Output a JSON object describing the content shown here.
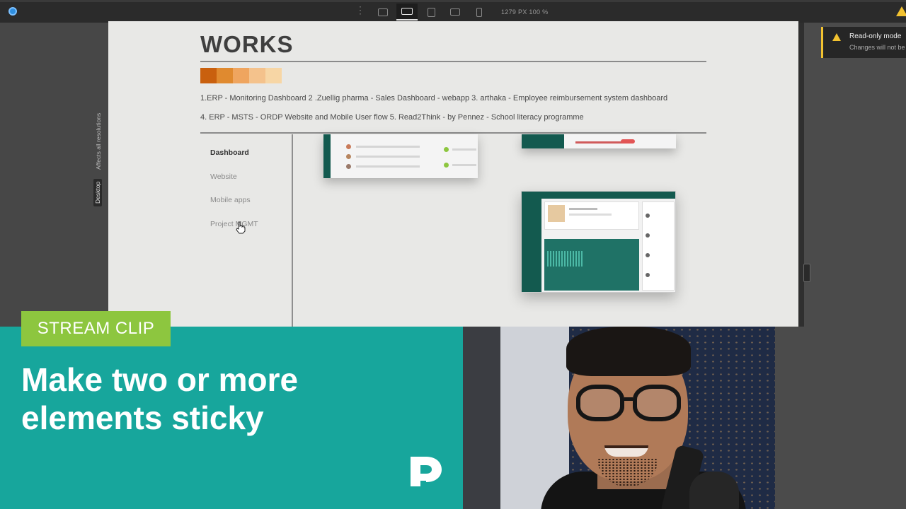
{
  "toolbar": {
    "size_label": "1279 PX   100 %",
    "devices": [
      "desktop-icon",
      "laptop-icon",
      "tablet-landscape-icon",
      "tablet-icon",
      "mobile-icon"
    ]
  },
  "gutter": {
    "affects_label": "Affects all resolutions",
    "breakpoint_label": "Desktop"
  },
  "canvas": {
    "title": "WORKS",
    "swatch_colors": [
      "#c9600e",
      "#e08a2f",
      "#efa55f",
      "#f4c28c",
      "#f7d6a5"
    ],
    "works_line_1": "1.ERP - Monitoring Dashboard   2 .Zuellig pharma - Sales Dashboard - webapp   3. arthaka - Employee reimbursement system dashboard",
    "works_line_2": "4. ERP - MSTS - ORDP Website and Mobile User flow   5. Read2Think - by Pennez - School literacy programme",
    "nav": [
      "Dashboard",
      "Website",
      "Mobile apps",
      "Project MGMT"
    ]
  },
  "toast": {
    "title": "Read-only mode",
    "body": "Changes will not be"
  },
  "banner": {
    "tag": "STREAM CLIP",
    "headline_line_1": "Make two or more",
    "headline_line_2": "elements sticky"
  },
  "colors": {
    "accent_teal": "#17a69c",
    "tag_green": "#8dc63f",
    "dashboard_green": "#135a4f",
    "warning": "#f2c230"
  }
}
